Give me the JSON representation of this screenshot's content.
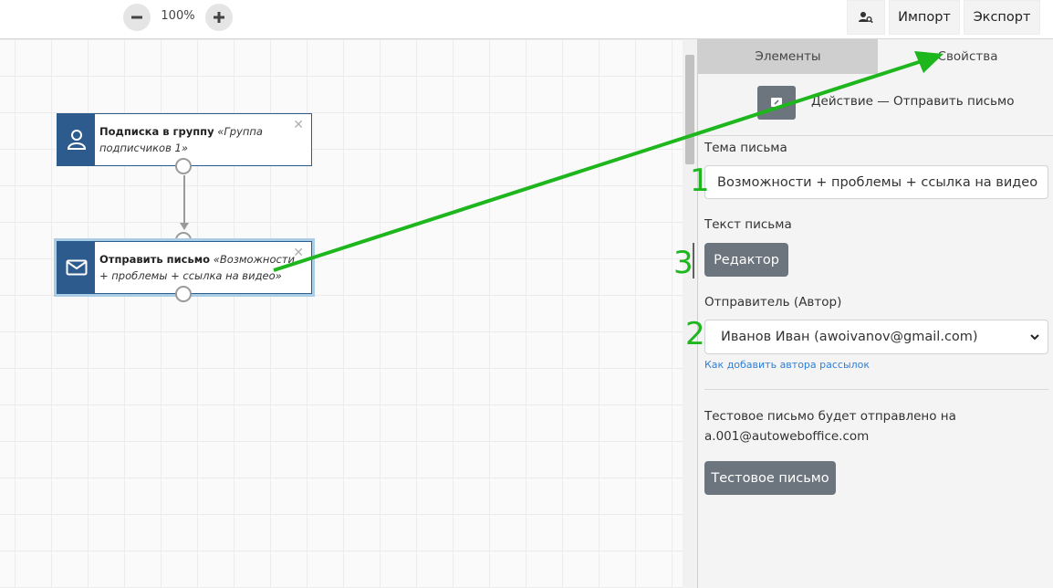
{
  "toolbar": {
    "zoom_out_icon": "minus-icon",
    "zoom_level": "100%",
    "zoom_in_icon": "plus-icon",
    "search_user_icon": "user-search-icon",
    "import_label": "Импорт",
    "export_label": "Экспорт"
  },
  "nodes": [
    {
      "icon": "user-icon",
      "title": "Подписка в группу",
      "detail": "«Группа подписчиков 1»",
      "selected": false
    },
    {
      "icon": "envelope-icon",
      "title": "Отправить письмо",
      "detail": "«Возможности + проблемы + ссылка на видео»",
      "selected": true
    }
  ],
  "panel": {
    "tabs": [
      {
        "label": "Элементы",
        "active": false
      },
      {
        "label": "Свойства",
        "active": true
      }
    ],
    "action_icon": "edit-icon",
    "action_title": "Действие — Отправить письмо",
    "subject_label": "Тема письма",
    "subject_value": "Возможности + проблемы + ссылка на видео",
    "body_label": "Текст письма",
    "editor_button": "Редактор",
    "sender_label": "Отправитель (Автор)",
    "sender_value": "Иванов Иван (awoivanov@gmail.com)",
    "sender_help_link": "Как добавить автора рассылок",
    "test_info_line1": "Тестовое письмо будет отправлено на",
    "test_info_line2": "a.001@autoweboffice.com",
    "test_button": "Тестовое письмо"
  },
  "annotations": {
    "color": "#1db61d",
    "markers": [
      "1",
      "2",
      "3"
    ]
  }
}
